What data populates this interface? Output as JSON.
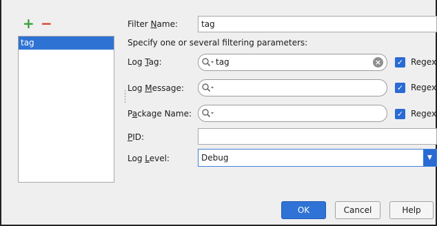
{
  "toolbar": {
    "add_icon": "plus-icon",
    "remove_icon": "minus-icon",
    "add_glyph": "+",
    "remove_glyph": "−"
  },
  "filter_list": {
    "items": [
      {
        "label": "tag",
        "selected": true
      }
    ]
  },
  "form": {
    "filter_name": {
      "label_pre": "Filter ",
      "label_u": "N",
      "label_post": "ame:",
      "value": "tag"
    },
    "hint": "Specify one or several filtering parameters:",
    "log_tag": {
      "label_pre": "Log ",
      "label_u": "T",
      "label_post": "ag:",
      "value": "tag",
      "regex_label": "Regex",
      "regex_checked": true
    },
    "log_message": {
      "label_pre": "Log ",
      "label_u": "M",
      "label_post": "essage:",
      "value": "",
      "regex_label": "Regex",
      "regex_checked": true
    },
    "package_name": {
      "label_pre": "P",
      "label_u": "a",
      "label_post": "ckage Name:",
      "value": "",
      "regex_label": "Regex",
      "regex_checked": true
    },
    "pid": {
      "label_pre": "",
      "label_u": "P",
      "label_post": "ID:",
      "value": ""
    },
    "log_level": {
      "label_pre": "Log ",
      "label_u": "L",
      "label_post": "evel:",
      "value": "Debug"
    }
  },
  "buttons": {
    "ok": "OK",
    "cancel": "Cancel",
    "help": "Help"
  },
  "colors": {
    "accent": "#2f73d6",
    "add": "#3aa13a",
    "remove": "#d6402e"
  }
}
